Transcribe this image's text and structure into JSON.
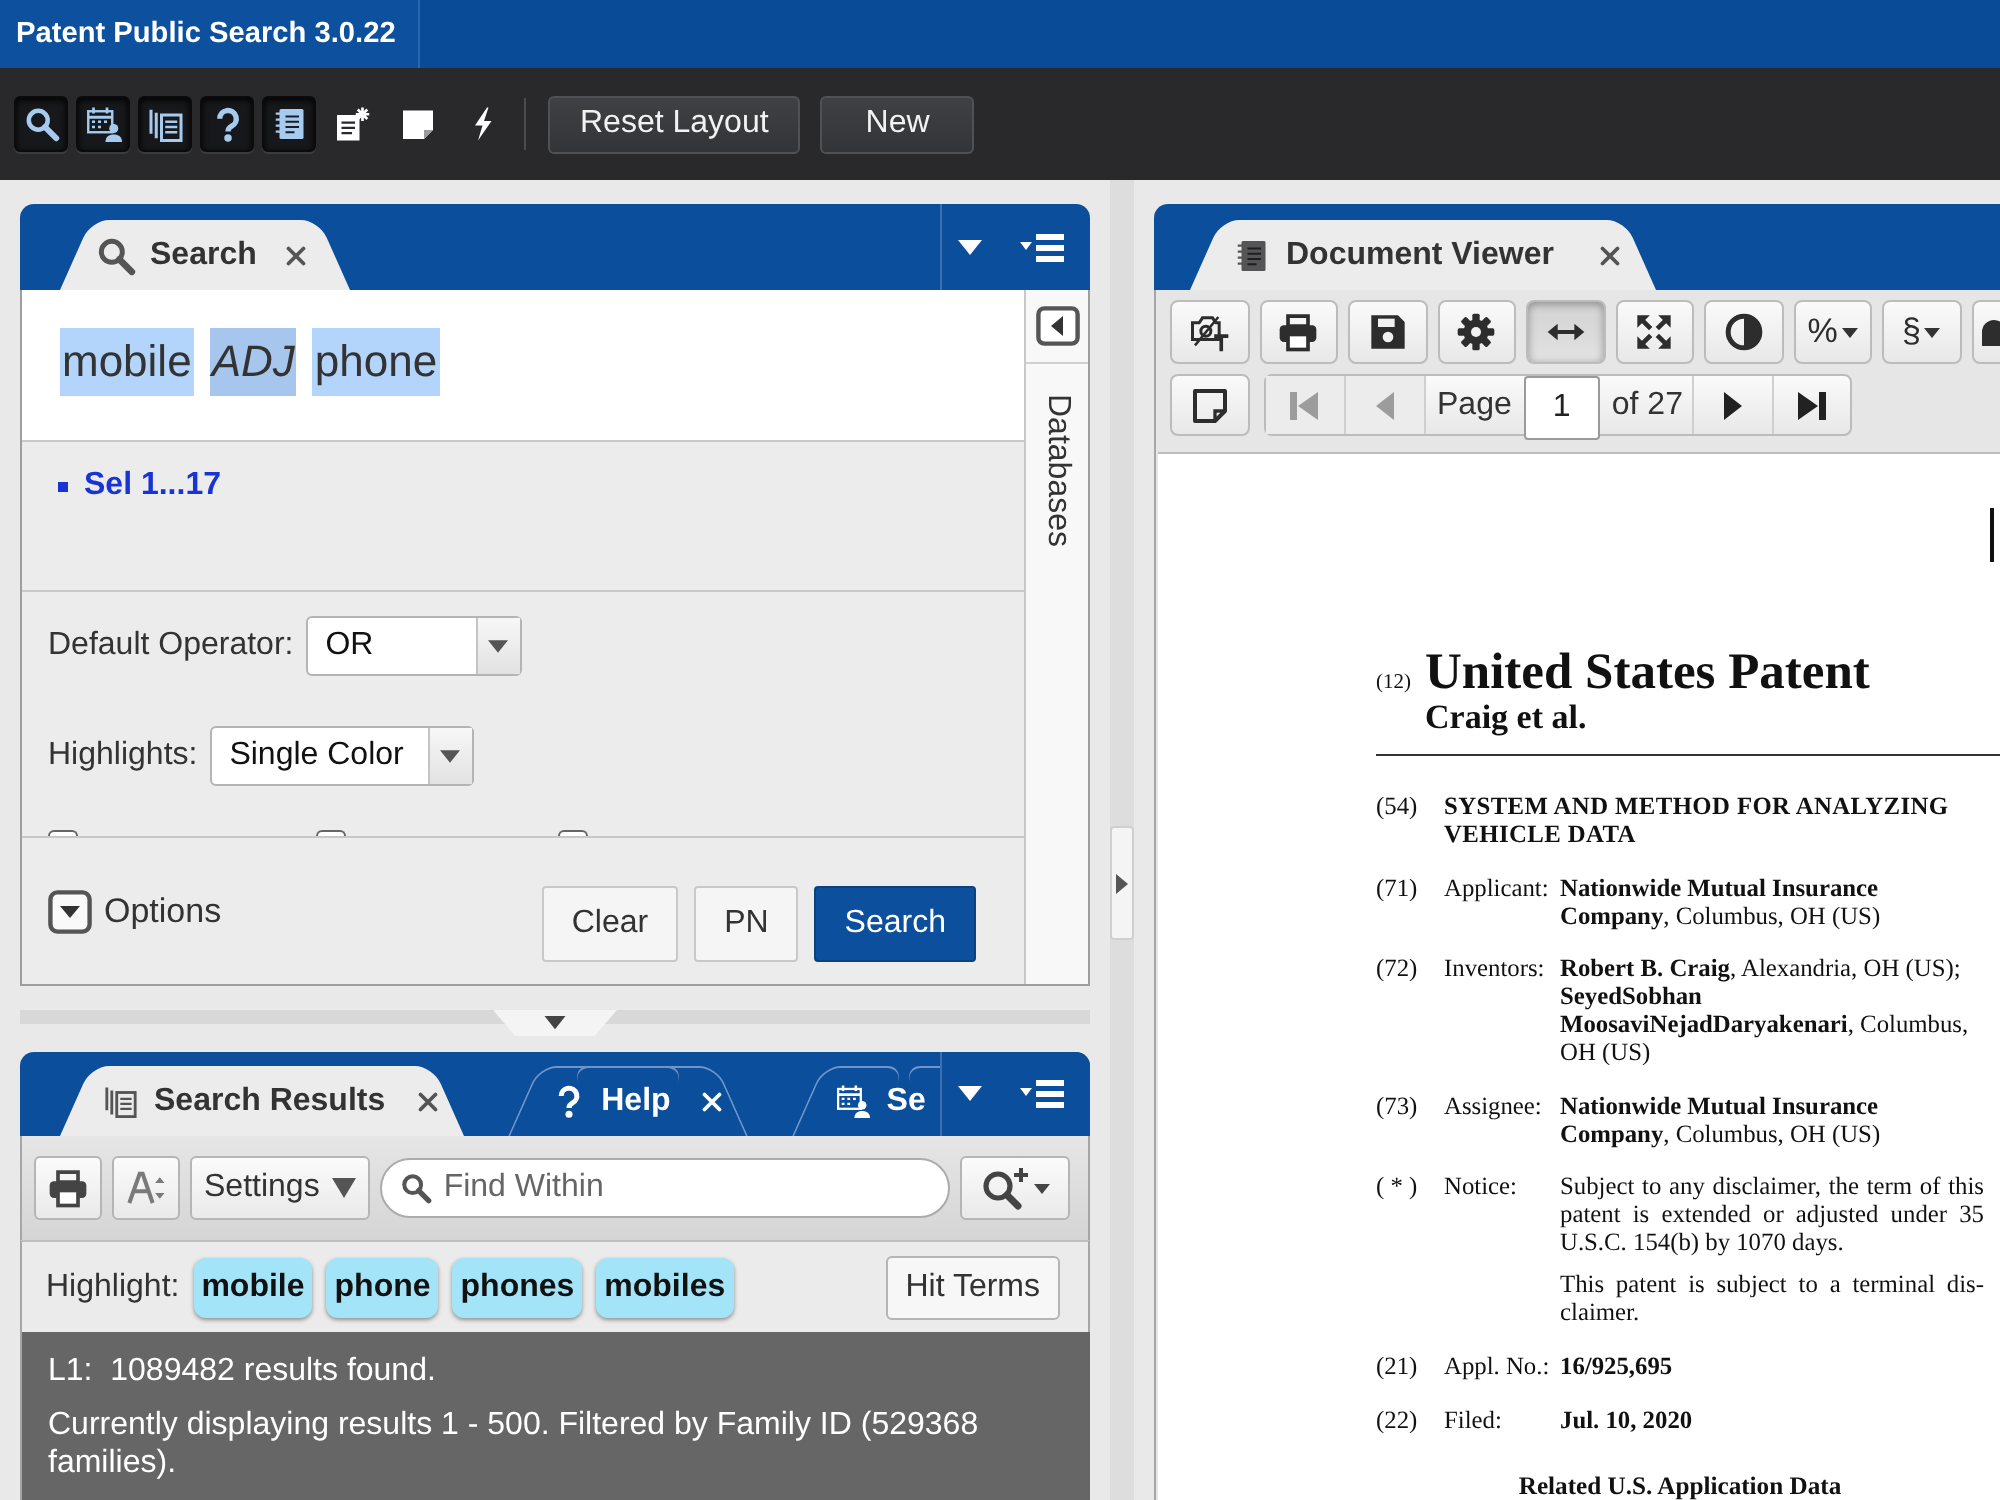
{
  "window": {
    "title": "Patent Public Search 3.0.22"
  },
  "toolbar": {
    "icons": [
      {
        "kind": "search",
        "open": true
      },
      {
        "kind": "calendar",
        "open": true
      },
      {
        "kind": "pages",
        "open": true
      },
      {
        "kind": "help",
        "open": true
      },
      {
        "kind": "notebook",
        "open": true
      },
      {
        "kind": "note-add",
        "open": false
      },
      {
        "kind": "sticky",
        "open": false
      },
      {
        "kind": "bolt",
        "open": false
      }
    ],
    "buttons": [
      "Reset Layout",
      "New"
    ]
  },
  "search_panel": {
    "tab": "Search",
    "query": [
      {
        "text": "mobile",
        "kind": "term"
      },
      {
        "text": "ADJ",
        "kind": "operator"
      },
      {
        "text": "phone",
        "kind": "term"
      }
    ],
    "history": [
      "Sel 1...17"
    ],
    "side_tab": "Databases",
    "fields": [
      {
        "label": "Default Operator:",
        "value": "OR"
      },
      {
        "label": "Highlights:",
        "value": "Single Color"
      }
    ],
    "checkboxes": [
      {
        "checked": false
      },
      {
        "checked": false
      },
      {
        "checked": false
      }
    ],
    "options_toggle": "Options",
    "buttons": [
      {
        "label": "Clear",
        "kind": "plain"
      },
      {
        "label": "PN",
        "kind": "plain"
      },
      {
        "label": "Search",
        "kind": "primary"
      }
    ]
  },
  "results_panel": {
    "tabs": [
      {
        "label": "Search Results",
        "kind": "results",
        "selected": true,
        "closable": true
      },
      {
        "label": "Help",
        "kind": "help",
        "selected": false,
        "closable": true
      },
      {
        "label": "Se",
        "kind": "calendar",
        "selected": false,
        "closable": false
      }
    ],
    "settings": "Settings",
    "find": {
      "placeholder": "Find Within"
    },
    "highlight_label": "Highlight:",
    "terms": [
      "mobile",
      "phone",
      "phones",
      "mobiles"
    ],
    "hit_terms": "Hit Terms",
    "summary": [
      "L1:  1089482 results found.",
      "Currently displaying results 1 - 500. Filtered by Family ID (529368 families)."
    ]
  },
  "document_viewer": {
    "tab": "Document Viewer",
    "tool_rows": [
      [
        {
          "kind": "camera-text",
          "selected": false
        },
        {
          "kind": "print",
          "selected": false
        },
        {
          "kind": "save",
          "selected": false
        },
        {
          "kind": "gear",
          "selected": false
        },
        {
          "kind": "fit-width",
          "selected": true
        },
        {
          "kind": "expand",
          "selected": false
        },
        {
          "kind": "contrast",
          "selected": false
        },
        {
          "kind": "menu",
          "label": "%",
          "selected": false
        },
        {
          "kind": "menu",
          "label": "§",
          "selected": false
        },
        {
          "kind": "dome",
          "selected": false
        }
      ],
      [
        {
          "kind": "note",
          "selected": false
        }
      ]
    ],
    "nav": [
      {
        "kind": "first",
        "disabled": true
      },
      {
        "kind": "prev",
        "disabled": true
      },
      {
        "kind": "next",
        "disabled": false
      },
      {
        "kind": "last",
        "disabled": false
      }
    ],
    "page": {
      "label": "Page",
      "value": "1",
      "total": "of 27"
    }
  },
  "document": {
    "code": "(12)",
    "title": "United States Patent",
    "authors": "Craig et al.",
    "fields": [
      {
        "code": "(54)",
        "kind": "title",
        "text": [
          "SYSTEM AND METHOD FOR ANALYZING VEHICLE DATA"
        ]
      },
      {
        "code": "(71)",
        "kind": "field",
        "label": "Applicant:",
        "text": [
          "**Nationwide Mutual Insurance Company**, Columbus, OH (US)"
        ]
      },
      {
        "code": "(72)",
        "kind": "field",
        "label": "Inventors:",
        "text": [
          "**Robert B. Craig**, Alexandria, OH (US); **SeyedSobhan MoosaviNejadDaryakenari**, Columbus, OH (US)"
        ]
      },
      {
        "code": "(73)",
        "kind": "field",
        "label": "Assignee:",
        "text": [
          "**Nationwide Mutual Insurance Company**, Columbus, OH (US)"
        ]
      },
      {
        "code": "( * )",
        "kind": "notice",
        "label": "Notice:",
        "text": [
          "Subject to any disclaimer, the term of this patent is extended or adjusted under 35 U.S.C. 154(b) by 1070 days.",
          "This patent is subject to a terminal dis-claimer."
        ]
      },
      {
        "code": "(21)",
        "kind": "field",
        "label": "Appl. No.:",
        "bold": true,
        "text": [
          "16/925,695"
        ]
      },
      {
        "code": "(22)",
        "kind": "field",
        "label": "Filed:",
        "bold": true,
        "text": [
          "Jul. 10, 2020"
        ]
      }
    ],
    "section": "Related U.S. Application Data"
  }
}
